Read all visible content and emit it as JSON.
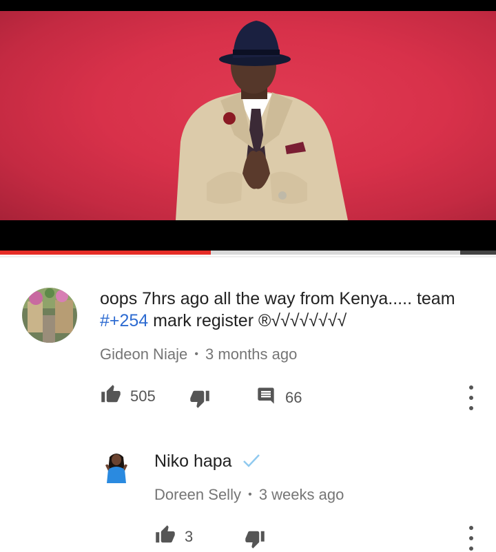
{
  "video": {
    "progress_fraction": 0.425
  },
  "comment": {
    "text_before_tag": "oops 7hrs ago all the way from Kenya..... team ",
    "hashtag": "#+254",
    "text_after_tag": " mark register ®√√√√√√√√",
    "author": "Gideon Niaje",
    "separator": "•",
    "time": "3 months ago",
    "like_count": "505",
    "reply_count": "66"
  },
  "reply": {
    "text": "Niko hapa",
    "author": "Doreen Selly",
    "separator": "•",
    "time": "3 weeks ago",
    "like_count": "3"
  },
  "icons": {
    "like": "thumbs-up-icon",
    "dislike": "thumbs-down-icon",
    "reply": "comment-icon",
    "more": "more-vert-icon",
    "verified": "checkmark-icon"
  },
  "colors": {
    "hashtag": "#2d6bd1",
    "progress": "#e52d27",
    "meta": "#757575",
    "verified": "#8fc9ef"
  }
}
